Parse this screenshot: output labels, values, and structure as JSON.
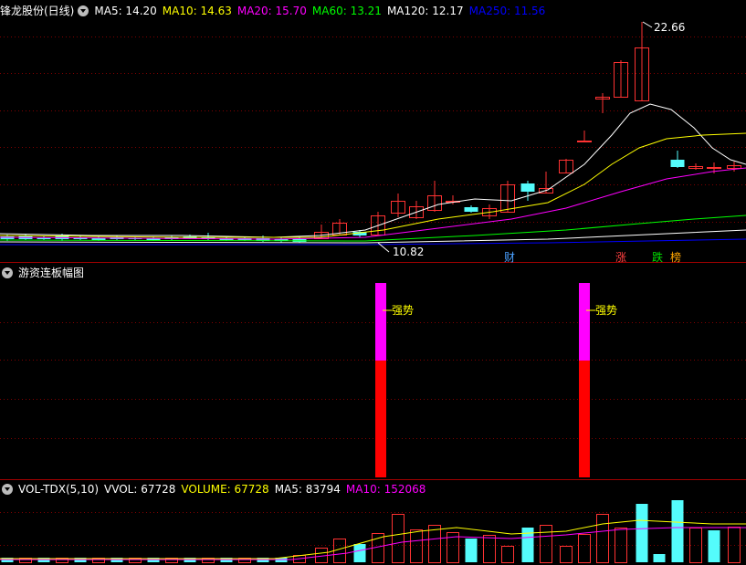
{
  "main_header": {
    "stock_title": "锋龙股份(日线)",
    "ma_items": [
      {
        "text": "MA5: 14.20",
        "color": "#ffffff"
      },
      {
        "text": "MA10: 14.63",
        "color": "#ffff00"
      },
      {
        "text": "MA20: 15.70",
        "color": "#ff00ff"
      },
      {
        "text": "MA60: 13.21",
        "color": "#00ff00"
      },
      {
        "text": "MA120: 12.17",
        "color": "#ffffff"
      },
      {
        "text": "MA250: 11.56",
        "color": "#0000ff"
      }
    ]
  },
  "price_annotations": {
    "high_label": "22.66",
    "low_label": "10.82"
  },
  "event_markers": [
    {
      "label": "财",
      "color": "#4aa0ff"
    },
    {
      "label": "涨",
      "color": "#ff4040"
    },
    {
      "label": "跌",
      "color": "#00e000"
    },
    {
      "label": "榜",
      "color": "#ffa500"
    }
  ],
  "indicator_panel": {
    "title": "游资连板幅图",
    "signal_label": "强势"
  },
  "volume_panel": {
    "title": "VOL-TDX(5,10)",
    "items": [
      {
        "text": "VVOL: 67728",
        "color": "#ffffff"
      },
      {
        "text": "VOLUME: 67728",
        "color": "#ffff00"
      },
      {
        "text": "MA5: 83794",
        "color": "#ffffff"
      },
      {
        "text": "MA10: 152068",
        "color": "#ff00ff"
      }
    ]
  },
  "colors": {
    "up": "#ff3232",
    "down": "#54fcfc",
    "grid": "#800000",
    "magenta": "#ff00ff",
    "red": "#ff0000"
  }
}
